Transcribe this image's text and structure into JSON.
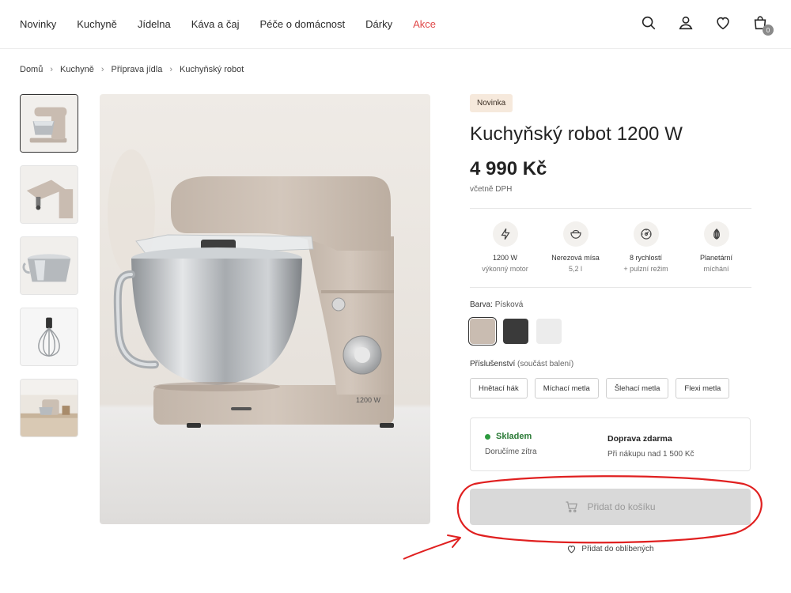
{
  "nav": {
    "links": [
      "Novinky",
      "Kuchyně",
      "Jídelna",
      "Káva a čaj",
      "Péče o domácnost",
      "Dárky",
      "Akce"
    ],
    "cart_count": "0",
    "icons": [
      "search-icon",
      "user-icon",
      "heart-icon",
      "cart-icon"
    ]
  },
  "breadcrumb": [
    "Domů",
    "Kuchyně",
    "Příprava jídla",
    "Kuchyňský robot"
  ],
  "product": {
    "badge": "Novinka",
    "title": "Kuchyňský robot 1200 W",
    "price": "4 990 Kč",
    "vat": "včetně DPH",
    "image_label": "1200 W"
  },
  "features": [
    {
      "icon": "lightning-icon",
      "title": "1200 W",
      "sub": "výkonný motor"
    },
    {
      "icon": "bowl-icon",
      "title": "Nerezová mísa",
      "sub": "5,2 l"
    },
    {
      "icon": "speed-dial-icon",
      "title": "8 rychlostí",
      "sub": "+ pulzní režim"
    },
    {
      "icon": "planetary-icon",
      "title": "Planetární",
      "sub": "míchání"
    }
  ],
  "color": {
    "label": "Barva:",
    "value": "Písková",
    "swatches": [
      "#c9bcb1",
      "#3a3a3a",
      "#ececec"
    ]
  },
  "accessories": {
    "label": "Příslušenství",
    "note": "(součást balení)",
    "items": [
      "Hnětací hák",
      "Míchací metla",
      "Šlehací metla",
      "Flexi metla"
    ]
  },
  "stock": {
    "status": "Skladem",
    "delivery": "Doručíme zítra",
    "shipping_title": "Doprava zdarma",
    "shipping_sub": "Při nákupu nad 1 500 Kč"
  },
  "actions": {
    "add_to_cart": "Přidat do košíku",
    "add_to_wishlist": "Přidat do oblíbených"
  },
  "colors": {
    "accent_sale": "#e04a4a",
    "stock_green": "#2c9a3e",
    "annotation_red": "#e02020",
    "button_disabled": "#d9d9d9"
  }
}
